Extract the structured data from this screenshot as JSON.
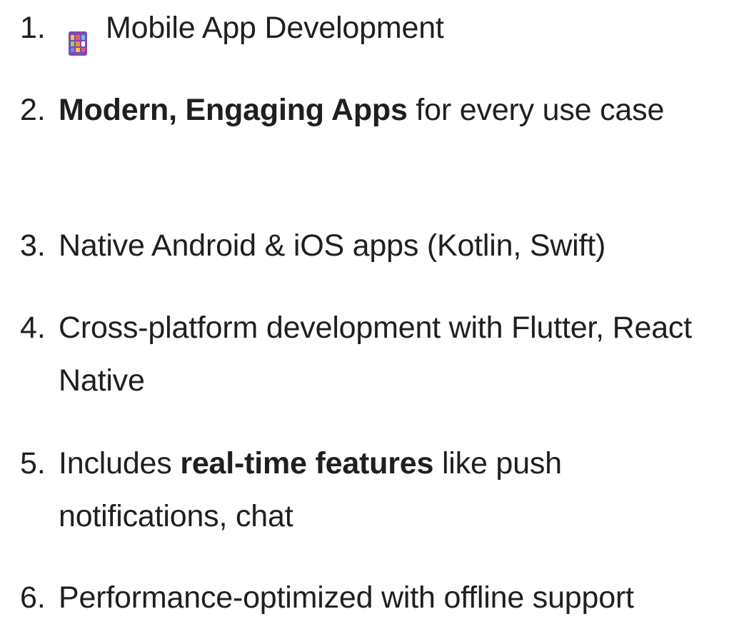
{
  "items": [
    {
      "number": "1.",
      "text": "Mobile App Development"
    },
    {
      "number": "2.",
      "bold": "Modern, Engaging Apps",
      "text": " for every use case"
    },
    {
      "number": "3.",
      "text": "Native Android & iOS apps (Kotlin, Swift)"
    },
    {
      "number": "4.",
      "text": "Cross-platform development with Flutter, React Native"
    },
    {
      "number": "5.",
      "text_before": "Includes ",
      "bold": "real-time features",
      "text_after": " like push notifications, chat"
    },
    {
      "number": "6.",
      "text": "Performance-optimized with offline support"
    }
  ],
  "icons": {
    "item1": "mobile-app-icon"
  },
  "colors": {
    "text": "#1f1f1f",
    "icon_bg": "#7e4bb0",
    "icon_tiles": [
      "#f4c542",
      "#e85d75",
      "#5ec4e8",
      "#7bd67b",
      "#f28c38",
      "#ffffff",
      "#5b8def",
      "#f4c542",
      "#e85d75"
    ]
  }
}
